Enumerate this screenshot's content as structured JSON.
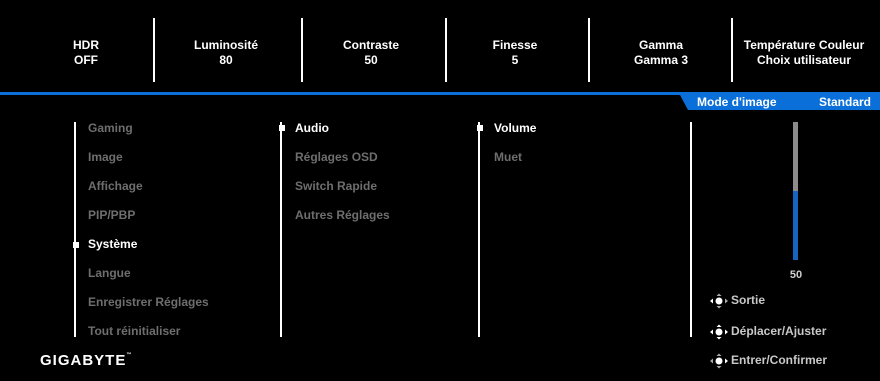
{
  "status": [
    {
      "label": "HDR",
      "value": "OFF"
    },
    {
      "label": "Luminosité",
      "value": "80"
    },
    {
      "label": "Contraste",
      "value": "50"
    },
    {
      "label": "Finesse",
      "value": "5"
    },
    {
      "label": "Gamma",
      "value": "Gamma 3"
    },
    {
      "label": "Température Couleur",
      "value": "Choix utilisateur"
    }
  ],
  "header": {
    "mode_label": "Mode d'image",
    "mode_value": "Standard"
  },
  "menu1": [
    "Gaming",
    "Image",
    "Affichage",
    "PIP/PBP",
    "Système",
    "Langue",
    "Enregistrer Réglages",
    "Tout réinitialiser"
  ],
  "menu1_selected": "Système",
  "menu2": [
    "Audio",
    "Réglages OSD",
    "Switch Rapide",
    "Autres Réglages"
  ],
  "menu2_selected": "Audio",
  "menu3": [
    "Volume",
    "Muet"
  ],
  "menu3_selected": "Volume",
  "slider": {
    "value": "50",
    "level_percent": 50
  },
  "hints": {
    "exit": "Sortie",
    "move": "Déplacer/Ajuster",
    "enter": "Entrer/Confirmer"
  },
  "brand": {
    "logo": "GIGABYTE",
    "tm": "™"
  },
  "colors": {
    "accent": "#0a6fd8",
    "inactive_text": "#6e6e6e",
    "slider_fill": "#1565c0"
  },
  "icons": {
    "joystick": "joystick-icon",
    "bullet": "square-bullet-icon"
  }
}
